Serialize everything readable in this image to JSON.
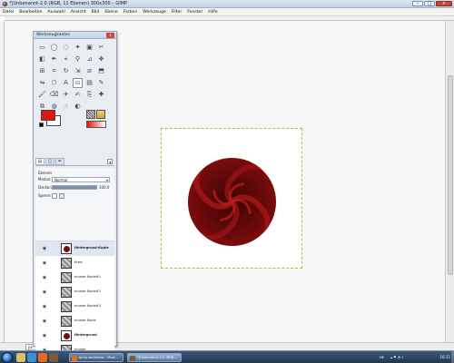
{
  "window": {
    "title": "*[Unbenannt-2.0 (RGB, 11 Ebenen) 300x300 – GIMP",
    "buttons": [
      "–",
      "□",
      "×"
    ]
  },
  "menubar": [
    "Datei",
    "Bearbeiten",
    "Auswahl",
    "Ansicht",
    "Bild",
    "Ebene",
    "Farben",
    "Werkzeuge",
    "Filter",
    "Fenster",
    "Hilfe"
  ],
  "toolbox": {
    "title": "Werkzeugkasten",
    "close": "×",
    "tools": [
      {
        "name": "rect-select-tool-icon",
        "glyph": "▭"
      },
      {
        "name": "ellipse-select-tool-icon",
        "glyph": "◯"
      },
      {
        "name": "free-select-tool-icon",
        "glyph": "◌"
      },
      {
        "name": "fuzzy-select-tool-icon",
        "glyph": "✦"
      },
      {
        "name": "color-select-tool-icon",
        "glyph": "▣"
      },
      {
        "name": "scissors-tool-icon",
        "glyph": "✂"
      },
      {
        "name": "foreground-select-tool-icon",
        "glyph": "◧"
      },
      {
        "name": "paths-tool-icon",
        "glyph": "✒"
      },
      {
        "name": "color-picker-tool-icon",
        "glyph": "⌖"
      },
      {
        "name": "zoom-tool-icon",
        "glyph": "⚲"
      },
      {
        "name": "measure-tool-icon",
        "glyph": "⊿"
      },
      {
        "name": "move-tool-icon",
        "glyph": "✥"
      },
      {
        "name": "align-tool-icon",
        "glyph": "⊞"
      },
      {
        "name": "crop-tool-icon",
        "glyph": "⌗"
      },
      {
        "name": "rotate-tool-icon",
        "glyph": "↻"
      },
      {
        "name": "scale-tool-icon",
        "glyph": "⇲"
      },
      {
        "name": "shear-tool-icon",
        "glyph": "⧄"
      },
      {
        "name": "perspective-tool-icon",
        "glyph": "⬒"
      },
      {
        "name": "flip-tool-icon",
        "glyph": "⇋"
      },
      {
        "name": "cage-tool-icon",
        "glyph": "⬡"
      },
      {
        "name": "text-tool-icon",
        "glyph": "A"
      },
      {
        "name": "bucket-fill-tool-icon",
        "glyph": "⛀"
      },
      {
        "name": "blend-tool-icon",
        "glyph": "▤"
      },
      {
        "name": "pencil-tool-icon",
        "glyph": "✎"
      },
      {
        "name": "paintbrush-tool-icon",
        "glyph": "🖌"
      },
      {
        "name": "eraser-tool-icon",
        "glyph": "⌫"
      },
      {
        "name": "airbrush-tool-icon",
        "glyph": "✈"
      },
      {
        "name": "ink-tool-icon",
        "glyph": "✍"
      },
      {
        "name": "clone-tool-icon",
        "glyph": "⎘"
      },
      {
        "name": "heal-tool-icon",
        "glyph": "✚"
      },
      {
        "name": "perspective-clone-tool-icon",
        "glyph": "⧉"
      },
      {
        "name": "blur-tool-icon",
        "glyph": "◍"
      },
      {
        "name": "smudge-tool-icon",
        "glyph": "☝"
      },
      {
        "name": "dodge-burn-tool-icon",
        "glyph": "◐"
      }
    ],
    "active_tool_index": 21,
    "fg_color": "#e01515",
    "bg_color": "#ffffff"
  },
  "layers_panel": {
    "title": "Ebenen",
    "mode_label": "Modus:",
    "mode_value": "Normal",
    "opacity_label": "Deckkraft",
    "opacity_value": "100,0",
    "opacity_fraction": 1.0,
    "lock_label": "Sperre:",
    "layers": [
      {
        "name": "Hintergrund-Kopie",
        "thumb": "circle",
        "bold": true,
        "selected": true
      },
      {
        "name": "Kreis",
        "thumb": "pattern",
        "bold": false,
        "selected": false
      },
      {
        "name": "muster-Kopie#1",
        "thumb": "pattern",
        "bold": false,
        "selected": false
      },
      {
        "name": "muster-Kopie#2",
        "thumb": "pattern",
        "bold": false,
        "selected": false
      },
      {
        "name": "muster-Kopie#3",
        "thumb": "pattern",
        "bold": false,
        "selected": false
      },
      {
        "name": "muster-Kopie",
        "thumb": "pattern",
        "bold": false,
        "selected": false
      },
      {
        "name": "Hintergrund",
        "thumb": "circle",
        "bold": true,
        "selected": false
      },
      {
        "name": "muster",
        "thumb": "pattern",
        "bold": false,
        "selected": false
      }
    ]
  },
  "canvas": {
    "image_bg": "#ffffff",
    "swirl_dark": "#4a0606",
    "swirl_light": "#a31616"
  },
  "statusbar": {
    "zoom": "px"
  },
  "taskbar": {
    "tasks": [
      {
        "label": "gimp-workshop - Mozi...",
        "active": false,
        "icon_color": "#e86a1a"
      },
      {
        "label": "*[Unbenannt-2.0 (RGB...",
        "active": true,
        "icon_color": "#7a5a3a"
      }
    ],
    "tray_lang": "DE",
    "clock": "16:11"
  }
}
